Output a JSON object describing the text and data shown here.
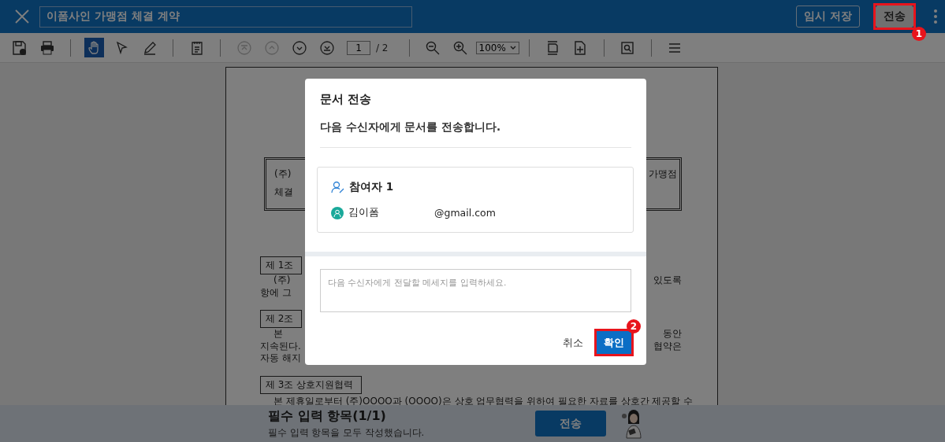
{
  "header": {
    "title_field": {
      "value": "이폼사인 가맹점 체결 계약"
    },
    "buttons": [
      {
        "label": "임시 저장",
        "kind": "outline"
      },
      {
        "label": "전송",
        "kind": "light",
        "marker": "1"
      }
    ]
  },
  "toolbar": {
    "modes": [
      {
        "selected": true
      },
      {
        "selected": false
      },
      {
        "selected": false
      },
      {
        "selected": false
      }
    ],
    "nav": [
      {
        "disabled": true
      },
      {
        "disabled": true
      },
      {
        "disabled": false
      },
      {
        "disabled": false
      }
    ],
    "page_field": {
      "value": "1"
    },
    "page_total": "/ 2",
    "zoom": {
      "value": "100%"
    }
  },
  "document": {
    "rows": [
      {
        "kind": "box",
        "left": [
          "(주)",
          "체결"
        ],
        "right": "가맹점"
      },
      {
        "kind": "heading",
        "left": "제 1조"
      },
      {
        "kind": "para",
        "left": "(주)",
        "right": "있도록"
      },
      {
        "kind": "line",
        "left": "항에 그"
      },
      {
        "kind": "heading",
        "left": "제 2조"
      },
      {
        "kind": "para",
        "left": "본",
        "right": "동안"
      },
      {
        "kind": "line",
        "left": "지속된다.",
        "right": "협약은"
      },
      {
        "kind": "line",
        "left": "자동 해지"
      },
      {
        "kind": "heading",
        "left": "제 3조  상호지원협력"
      },
      {
        "kind": "para",
        "left": "본 제휴일로부터 (주)OOOO과 (OOOO)은 상호 업무협력을 위하여 필요한 자료를 상호간 제공할 수"
      }
    ]
  },
  "dialog": {
    "title": "문서 전송",
    "message": "다음 수신자에게 문서를 전송합니다.",
    "participants": [
      {
        "label": "참여자 1",
        "members": [
          {
            "name": "김이폼",
            "email": "@gmail.com"
          }
        ]
      }
    ],
    "message_field": {
      "placeholder": "다음 수신자에게 전달할 메세지를 입력하세요."
    },
    "buttons": [
      {
        "label": "취소",
        "kind": "text"
      },
      {
        "label": "확인",
        "kind": "primary",
        "marker": "2"
      }
    ]
  },
  "bottom_bar": {
    "title": "필수 입력 항목(1/1)",
    "subtitle": "필수 입력 항목을 모두 작성했습니다.",
    "button": "전송"
  }
}
